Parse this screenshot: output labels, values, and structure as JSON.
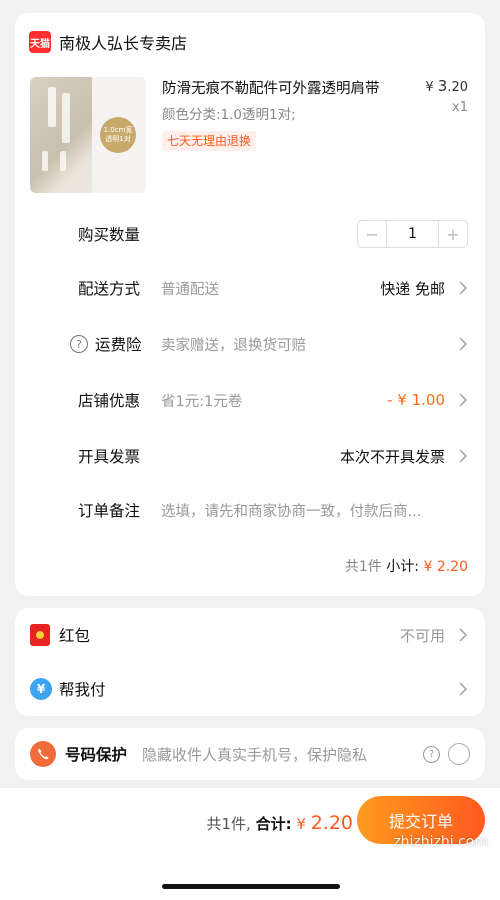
{
  "store": {
    "badge": "天猫",
    "name": "南极人弘长专卖店"
  },
  "product": {
    "title": "防滑无痕不勒配件可外露透明肩带",
    "price_symbol": "¥ ",
    "price_int": "3",
    "price_dec": ".20",
    "quantity": "x1",
    "spec": "颜色分类:1.0透明1对;",
    "return_tag": "七天无理由退换",
    "image_badge_line1": "1.0cm宽",
    "image_badge_line2": "透明1对"
  },
  "rows": {
    "quantity_label": "购买数量",
    "quantity_value": "1",
    "minus": "−",
    "plus": "+",
    "delivery_label": "配送方式",
    "delivery_value": "普通配送",
    "delivery_right": "快递 免邮",
    "insurance_label": "运费险",
    "insurance_value": "卖家赠送，退换货可赔",
    "shop_discount_label": "店铺优惠",
    "shop_discount_value": "省1元:1元卷",
    "shop_discount_right": "- ¥ 1.00",
    "invoice_label": "开具发票",
    "invoice_right": "本次不开具发票",
    "note_label": "订单备注",
    "note_placeholder": "选填，请先和商家协商一致，付款后商..."
  },
  "subtotal": {
    "count": "共1件",
    "label": "小计:",
    "amount": "¥ 2.20"
  },
  "payment": {
    "redpacket_label": "红包",
    "redpacket_status": "不可用",
    "helppay_label": "帮我付"
  },
  "privacy": {
    "label": "号码保护",
    "desc": "隐藏收件人真实手机号，保护隐私"
  },
  "footer": {
    "count": "共1件,",
    "total_label": "合计:",
    "symbol": "¥ ",
    "amount": "2.20",
    "submit": "提交订单",
    "watermark": "zhizhizhi.com"
  },
  "colors": {
    "accent": "#ff5a1f",
    "tmall_red": "#ff2d2d"
  }
}
